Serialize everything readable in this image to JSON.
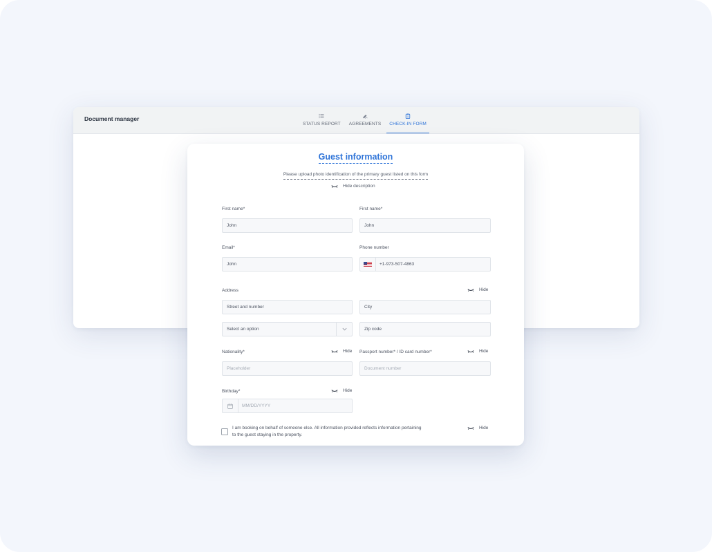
{
  "app": {
    "title": "Document manager"
  },
  "tabs": [
    {
      "label": "STATUS REPORT",
      "icon": "list-icon",
      "active": false
    },
    {
      "label": "AGREEMENTS",
      "icon": "signature-icon",
      "active": false
    },
    {
      "label": "CHECK-IN FORM",
      "icon": "clipboard-icon",
      "active": true
    }
  ],
  "form": {
    "title": "Guest information",
    "description": "Please upload photo identification of the primary guest listed on this form",
    "hide_description": "Hide description",
    "hide_label": "Hide",
    "first_name_1": {
      "label": "First name*",
      "value": "John"
    },
    "first_name_2": {
      "label": "First name*",
      "value": "John"
    },
    "email": {
      "label": "Email*",
      "value": "John"
    },
    "phone": {
      "label": "Phone number",
      "value": "+1-973-507-4863",
      "flag": "us-flag-icon"
    },
    "address": {
      "label": "Address",
      "street_placeholder": "Street and number",
      "city_placeholder": "City",
      "select_placeholder": "Select an option",
      "zip_placeholder": "Zip code"
    },
    "nationality": {
      "label": "Nationality*",
      "placeholder": "Placeholder"
    },
    "passport": {
      "label": "Passport number* / ID card number*",
      "placeholder": "Document number"
    },
    "birthday": {
      "label": "Birthday*",
      "placeholder": "MM/DD/YYYY"
    },
    "on_behalf": {
      "line1": "I am booking on behalf of someone else. All information provided reflects information pertaining",
      "line2": "to the guest staying in the property.",
      "checked": false
    }
  },
  "colors": {
    "accent": "#2f74d8",
    "background": "#f3f6fc"
  }
}
